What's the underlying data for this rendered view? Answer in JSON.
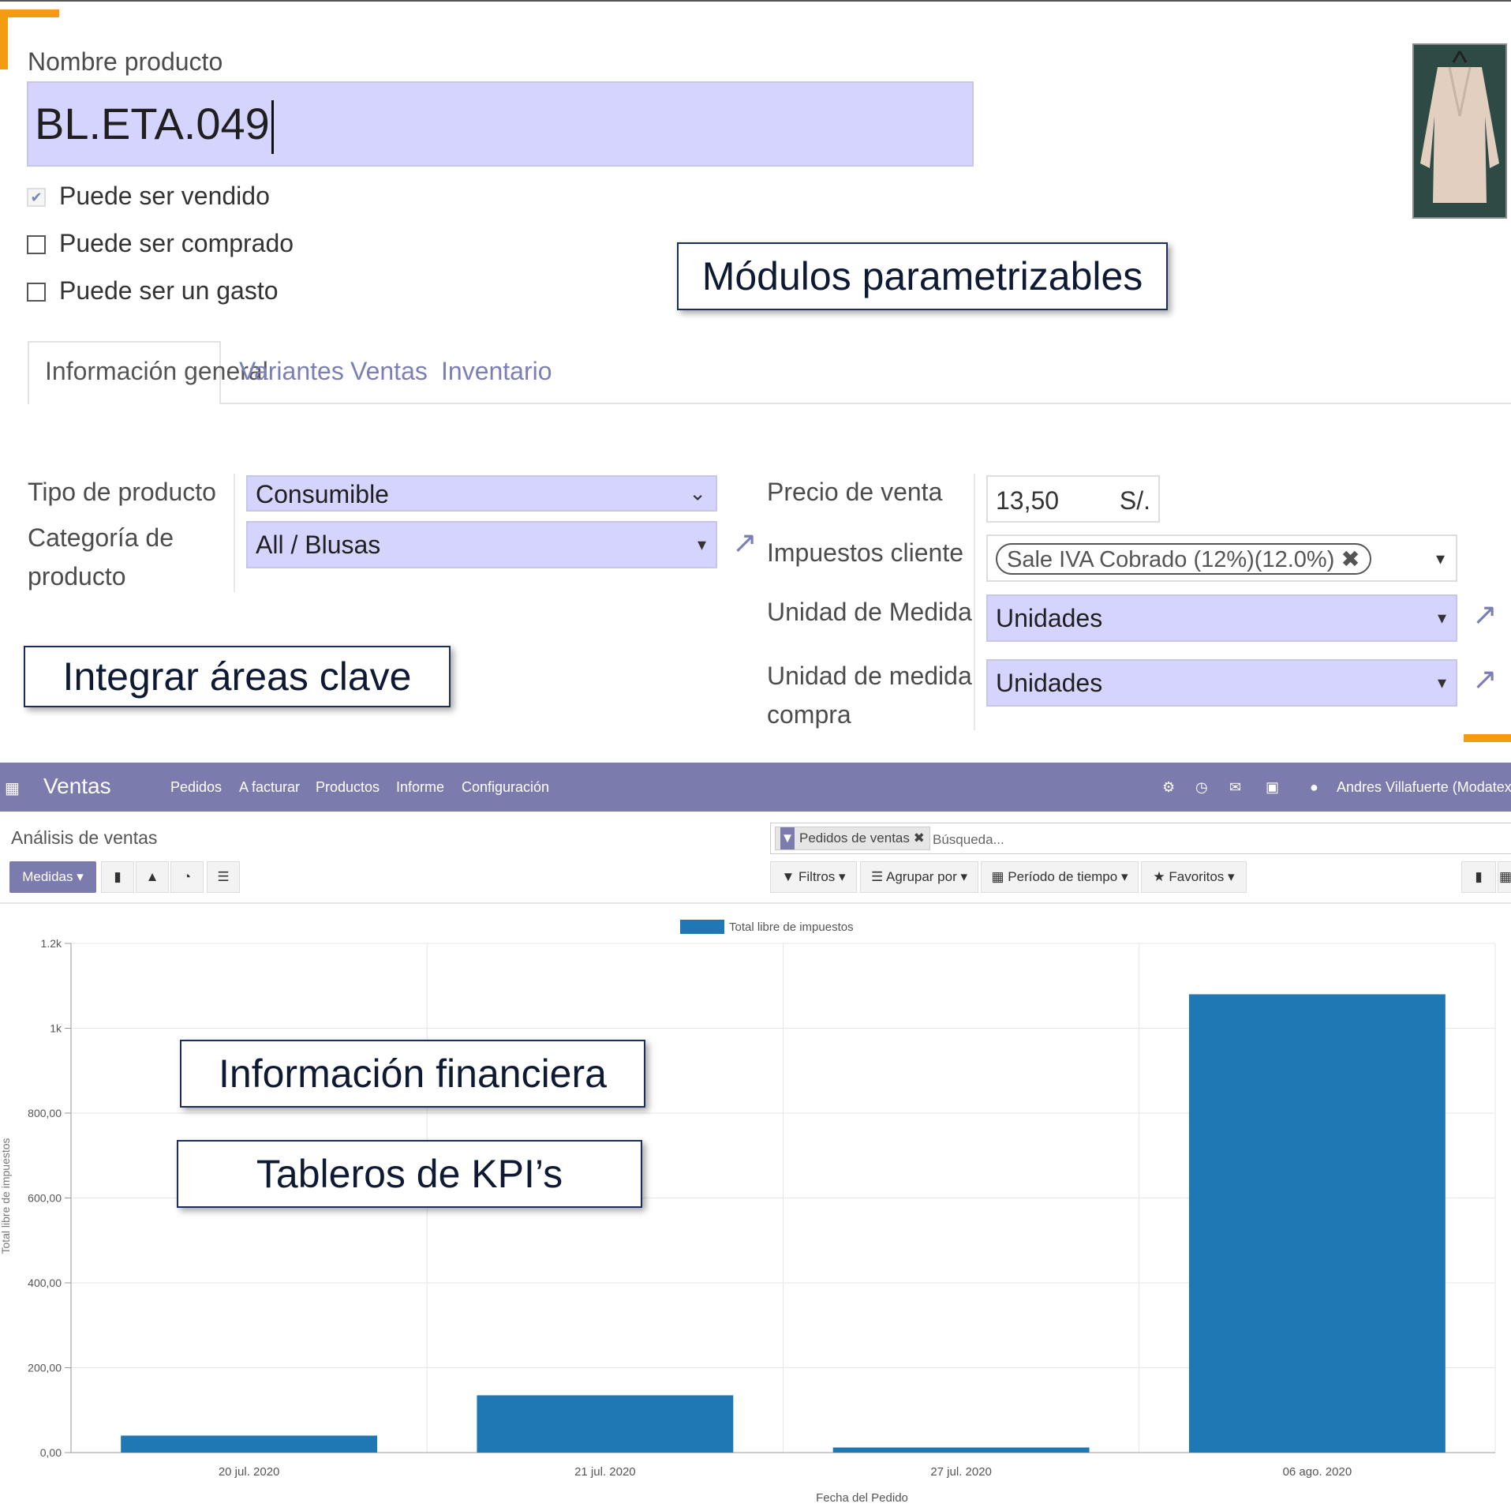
{
  "product_form": {
    "name_label": "Nombre producto",
    "name_value": "BL.ETA.049",
    "checkboxes": [
      {
        "label": "Puede ser vendido",
        "checked": true
      },
      {
        "label": "Puede ser comprado",
        "checked": false
      },
      {
        "label": "Puede ser un gasto",
        "checked": false
      }
    ],
    "tabs": [
      "Información general",
      "Variantes",
      "Ventas",
      "Inventario"
    ],
    "fields": {
      "tipo_label": "Tipo de producto",
      "tipo_value": "Consumible",
      "categoria_label_1": "Categoría de",
      "categoria_label_2": "producto",
      "categoria_value": "All / Blusas",
      "precio_label": "Precio de venta",
      "precio_value": "13,50",
      "precio_currency": "S/.",
      "impuestos_label": "Impuestos cliente",
      "impuestos_tag": "Sale IVA Cobrado (12%)(12.0%)",
      "uom_label": "Unidad de Medida",
      "uom_value": "Unidades",
      "uom_po_label_1": "Unidad de medida",
      "uom_po_label_2": "compra",
      "uom_po_value": "Unidades"
    }
  },
  "callouts": {
    "modulos": "Módulos parametrizables",
    "integrar": "Integrar áreas clave",
    "financiera": "Información financiera",
    "kpi": "Tableros de KPI’s"
  },
  "app": {
    "brand": "Ventas",
    "menu": [
      "Pedidos",
      "A facturar",
      "Productos",
      "Informe",
      "Configuración"
    ],
    "user": "Andres Villafuerte (Modatextil",
    "breadcrumb": "Análisis de ventas",
    "search_facet": "Pedidos de ventas",
    "search_placeholder": "Búsqueda...",
    "measures_button": "Medidas",
    "filters": [
      "Filtros",
      "Agrupar por",
      "Período de tiempo",
      "Favoritos"
    ]
  },
  "colors": {
    "nav": "#7c7bad",
    "input_bg": "#d4d4ff",
    "bar": "#1f77b4",
    "accent_orange": "#f39c12"
  },
  "chart_data": {
    "type": "bar",
    "categories": [
      "20 jul. 2020",
      "21 jul. 2020",
      "27 jul. 2020",
      "06 ago. 2020"
    ],
    "series": [
      {
        "name": "Total libre de impuestos",
        "values": [
          40,
          135,
          12,
          1080
        ]
      }
    ],
    "xlabel": "Fecha del Pedido",
    "ylabel": "Total libre de impuestos",
    "ylim": [
      0,
      1200
    ],
    "yticks": [
      {
        "value": 0,
        "label": "0,00"
      },
      {
        "value": 200,
        "label": "200,00"
      },
      {
        "value": 400,
        "label": "400,00"
      },
      {
        "value": 600,
        "label": "600,00"
      },
      {
        "value": 800,
        "label": "800,00"
      },
      {
        "value": 1000,
        "label": "1k"
      },
      {
        "value": 1200,
        "label": "1.2k"
      }
    ],
    "grid": true,
    "legend": "top"
  }
}
